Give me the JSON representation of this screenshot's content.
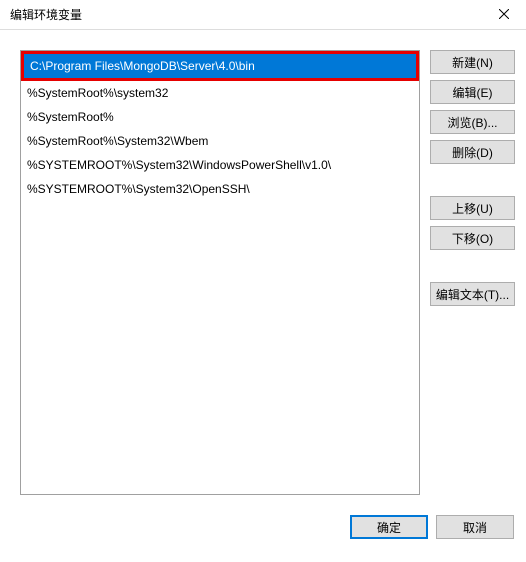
{
  "title": "编辑环境变量",
  "list": {
    "items": [
      "C:\\Program Files\\MongoDB\\Server\\4.0\\bin",
      "%SystemRoot%\\system32",
      "%SystemRoot%",
      "%SystemRoot%\\System32\\Wbem",
      "%SYSTEMROOT%\\System32\\WindowsPowerShell\\v1.0\\",
      "%SYSTEMROOT%\\System32\\OpenSSH\\"
    ],
    "selected_index": 0,
    "highlighted_index": 0
  },
  "buttons": {
    "new": "新建(N)",
    "edit": "编辑(E)",
    "browse": "浏览(B)...",
    "delete": "删除(D)",
    "move_up": "上移(U)",
    "move_down": "下移(O)",
    "edit_text": "编辑文本(T)...",
    "ok": "确定",
    "cancel": "取消"
  }
}
